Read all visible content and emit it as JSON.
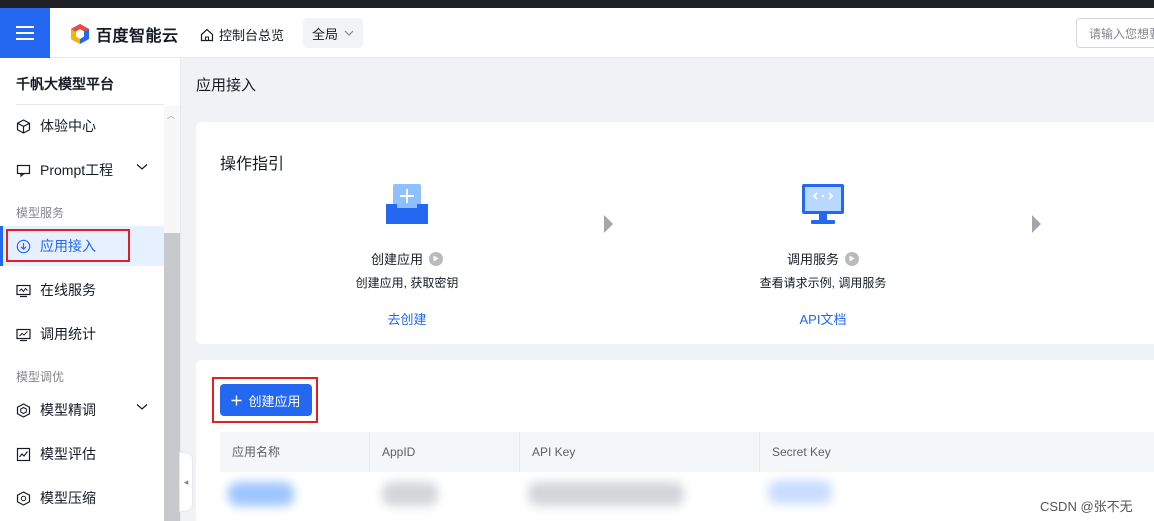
{
  "header": {
    "brand": "百度智能云",
    "home_link": "控制台总览",
    "region": "全局",
    "search_placeholder": "请输入您想要"
  },
  "sidebar": {
    "title": "千帆大模型平台",
    "items": [
      {
        "label": "体验中心"
      },
      {
        "label": "Prompt工程"
      },
      {
        "label": "应用接入"
      },
      {
        "label": "在线服务"
      },
      {
        "label": "调用统计"
      },
      {
        "label": "模型精调"
      },
      {
        "label": "模型评估"
      },
      {
        "label": "模型压缩"
      }
    ],
    "groups": [
      "模型服务",
      "模型调优"
    ]
  },
  "main": {
    "page_title": "应用接入",
    "guide": {
      "title": "操作指引",
      "steps": [
        {
          "name": "创建应用",
          "desc": "创建应用, 获取密钥",
          "link": "去创建"
        },
        {
          "name": "调用服务",
          "desc": "查看请求示例, 调用服务",
          "link": "API文档"
        }
      ]
    },
    "create_button": "创建应用",
    "table": {
      "columns": [
        "应用名称",
        "AppID",
        "API Key",
        "Secret Key"
      ]
    }
  },
  "watermark": "CSDN @张不无",
  "colors": {
    "accent": "#2468f2",
    "annotation": "#e02020"
  }
}
